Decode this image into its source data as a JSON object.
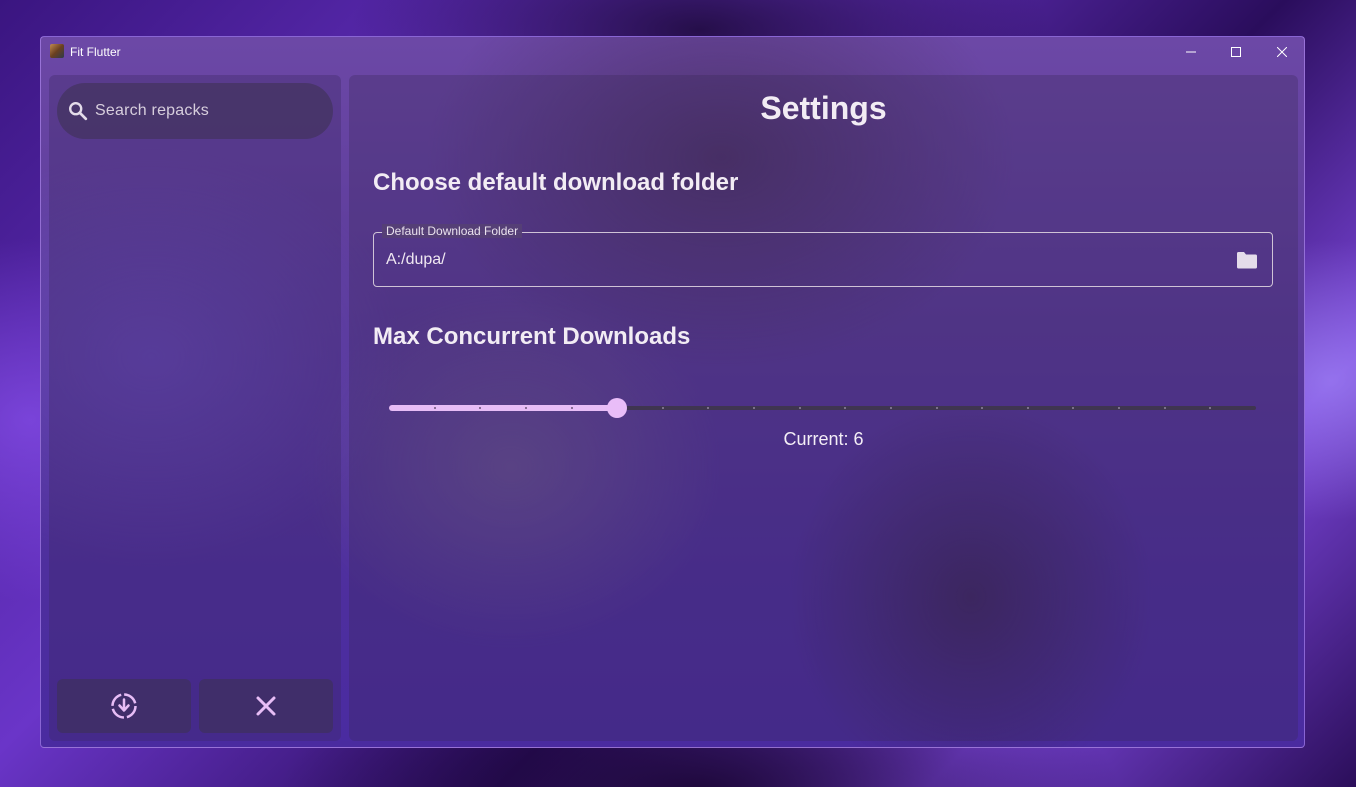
{
  "window": {
    "title": "Fit Flutter",
    "controls": {
      "minimize": "minimize-icon",
      "maximize": "maximize-icon",
      "close": "close-icon"
    }
  },
  "sidebar": {
    "search": {
      "placeholder": "Search repacks",
      "value": ""
    },
    "buttons": [
      {
        "name": "download-manager",
        "icon": "download-circle-icon"
      },
      {
        "name": "close",
        "icon": "close-icon"
      }
    ]
  },
  "settings": {
    "title": "Settings",
    "download_folder": {
      "heading": "Choose default download folder",
      "field_label": "Default Download Folder",
      "value": "A:/dupa/",
      "icon": "folder-icon"
    },
    "concurrent": {
      "heading": "Max Concurrent Downloads",
      "min": 1,
      "max": 20,
      "value": 6,
      "current_text": "Current: 6"
    }
  },
  "colors": {
    "accent": "#e7bdf6",
    "track_inactive": "#3f3550",
    "text": "#f2ecf4"
  }
}
